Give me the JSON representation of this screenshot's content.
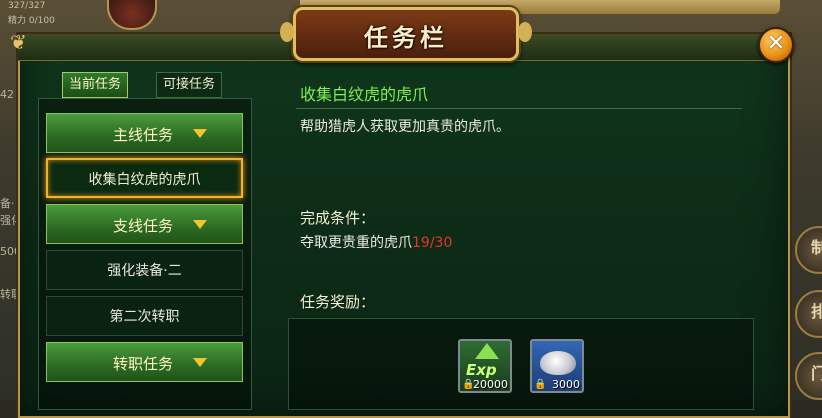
{
  "window": {
    "title": "任务栏",
    "close_glyph": "✕"
  },
  "background_hud": {
    "hp_text": "327/327",
    "mp_text": "精力 0/100",
    "side_texts": [
      "42",
      "备·",
      "强化·",
      "500",
      "转职"
    ],
    "right_buttons": [
      "制",
      "排",
      "门"
    ]
  },
  "tabs": {
    "current": "当前任务",
    "available": "可接任务"
  },
  "quest_list": {
    "main_category": "主线任务",
    "main_quest": "收集白纹虎的虎爪",
    "side_category": "支线任务",
    "side_quests": [
      "强化装备·二",
      "第二次转职"
    ],
    "job_category": "转职任务"
  },
  "quest_detail": {
    "title": "收集白纹虎的虎爪",
    "description": "帮助猎虎人获取更加真贵的虎爪。",
    "condition_label": "完成条件：",
    "condition_text": "夺取更贵重的虎爪",
    "condition_progress": "19/30",
    "reward_label": "任务奖励：",
    "rewards": [
      {
        "icon": "exp-icon",
        "label": "Exp",
        "amount": "20000"
      },
      {
        "icon": "silver-ingot-icon",
        "amount": "3000"
      }
    ]
  },
  "colors": {
    "quest_title": "#7cf24c",
    "progress": "#e8342a",
    "selected_border": "#f0b32c"
  }
}
